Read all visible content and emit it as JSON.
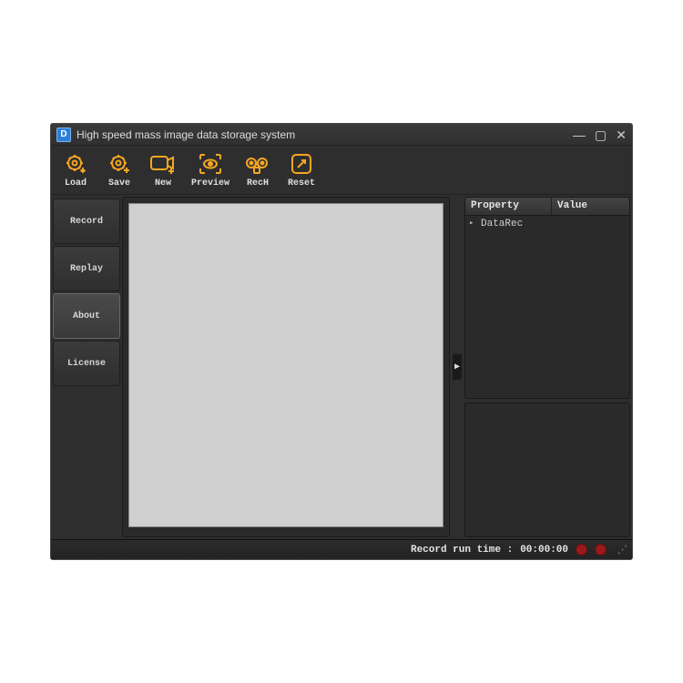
{
  "window": {
    "title": "High speed mass image data storage system"
  },
  "toolbar": {
    "load": {
      "label": "Load"
    },
    "save": {
      "label": "Save"
    },
    "new": {
      "label": "New"
    },
    "preview": {
      "label": "Preview"
    },
    "rech": {
      "label": "RecH"
    },
    "reset": {
      "label": "Reset"
    }
  },
  "sidebar": {
    "record": {
      "label": "Record"
    },
    "replay": {
      "label": "Replay"
    },
    "about": {
      "label": "About"
    },
    "license": {
      "label": "License"
    }
  },
  "properties": {
    "header_property": "Property",
    "header_value": "Value",
    "rows": {
      "0": {
        "name": "DataRec"
      }
    }
  },
  "status": {
    "runtime_label": "Record run time :",
    "runtime_value": "00:00:00"
  },
  "colors": {
    "accent": "#f5a623"
  }
}
